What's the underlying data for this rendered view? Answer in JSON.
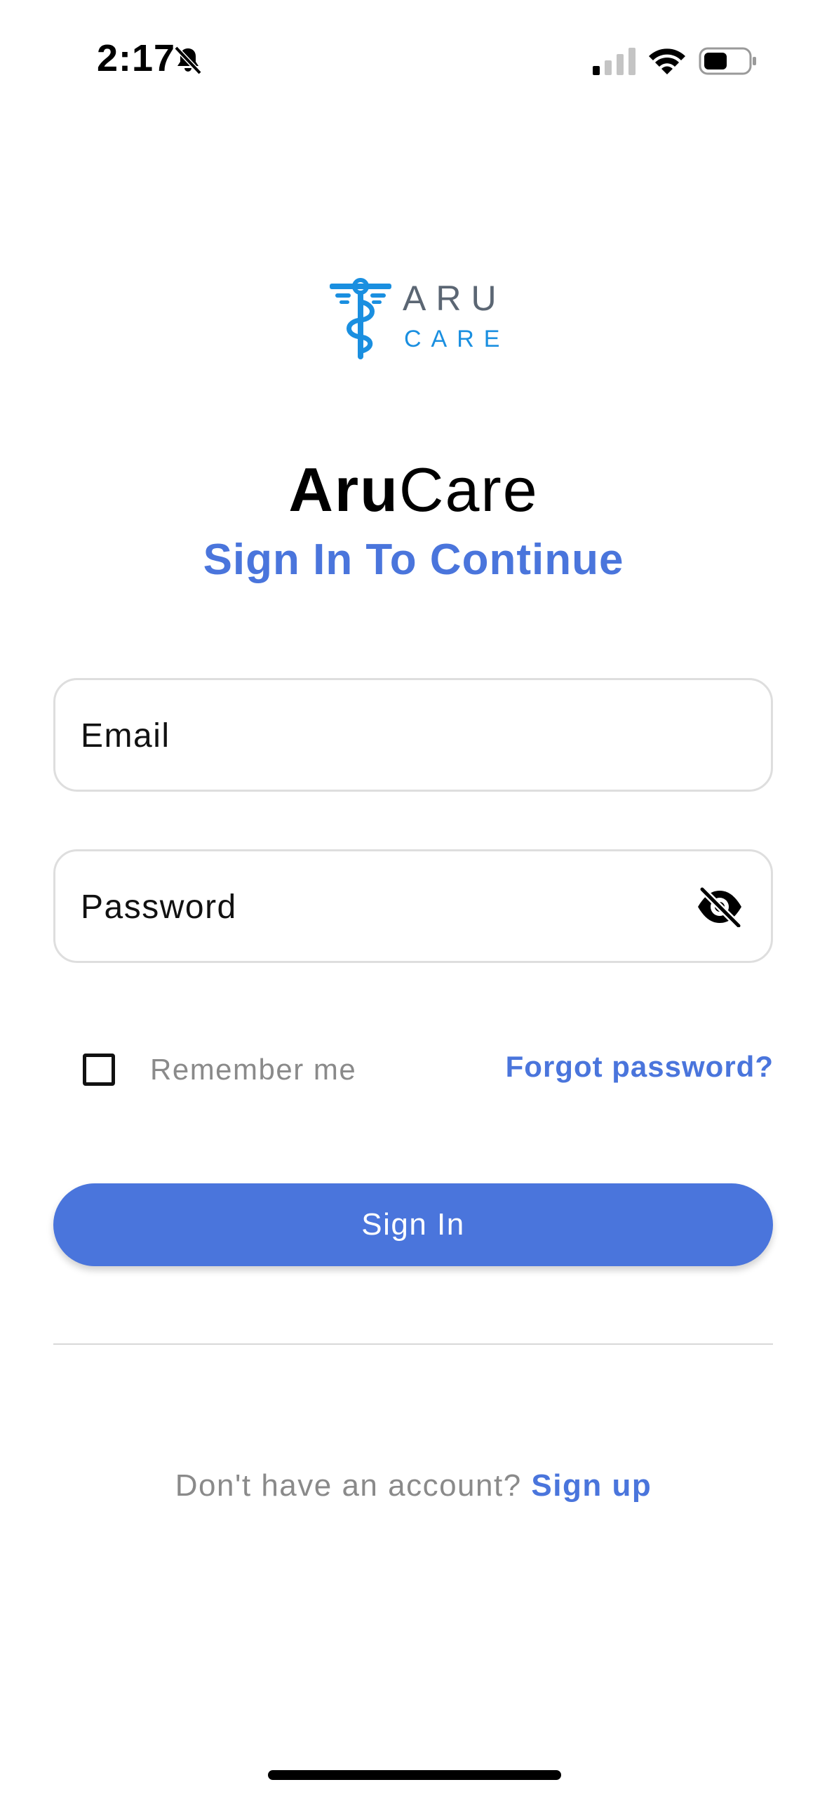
{
  "status_bar": {
    "time": "2:17",
    "icons": [
      "bell-muted-icon",
      "signal-icon",
      "wifi-icon",
      "battery-icon"
    ]
  },
  "logo": {
    "word_top": "ARU",
    "word_bottom": "CARE",
    "emblem_icon": "caduceus-icon",
    "colors": {
      "emblem": "#1a8fe0",
      "word_top": "#5b6673",
      "word_bottom": "#1a8fe0"
    }
  },
  "header": {
    "title_bold": "Aru",
    "title_light": "Care",
    "subtitle": "Sign In To Continue"
  },
  "form": {
    "email": {
      "placeholder": "Email",
      "value": ""
    },
    "password": {
      "placeholder": "Password",
      "value": "",
      "toggle_icon": "eye-off-icon"
    },
    "remember_me": {
      "label": "Remember me",
      "checked": false
    },
    "forgot_password": "Forgot password?",
    "submit": "Sign In"
  },
  "footer": {
    "prompt": "Don't have an account?",
    "signup": "Sign up"
  },
  "colors": {
    "accent": "#4a75dc",
    "muted_text": "#8a8a8a",
    "border": "#dedede"
  }
}
